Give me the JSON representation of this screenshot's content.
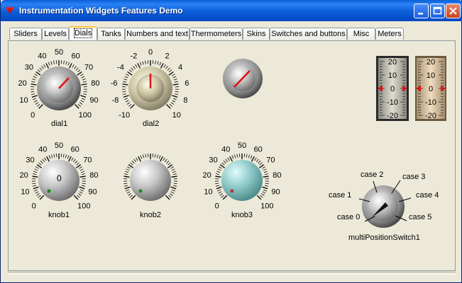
{
  "window": {
    "title": "Instrumentation Widgets Features Demo"
  },
  "tabs": [
    {
      "label": "Sliders"
    },
    {
      "label": "Levels"
    },
    {
      "label": "Dials"
    },
    {
      "label": "Tanks"
    },
    {
      "label": "Numbers and text"
    },
    {
      "label": "Thermometers"
    },
    {
      "label": "Skins"
    },
    {
      "label": "Switches and buttons"
    },
    {
      "label": "Misc"
    },
    {
      "label": "Meters"
    }
  ],
  "active_tab": "Dials",
  "dials": {
    "dial1": {
      "label": "dial1",
      "ticks": [
        "0",
        "10",
        "20",
        "30",
        "40",
        "50",
        "60",
        "70",
        "80",
        "90",
        "100"
      ],
      "value": 60
    },
    "dial2": {
      "label": "dial2",
      "ticks": [
        "-10",
        "-8",
        "-6",
        "-4",
        "-2",
        "0",
        "2",
        "4",
        "6",
        "8",
        "10"
      ],
      "value": 0
    },
    "dial3": {
      "value": 65
    }
  },
  "knobs": {
    "knob1": {
      "label": "knob1",
      "ticks": [
        "0",
        "10",
        "20",
        "30",
        "40",
        "50",
        "60",
        "70",
        "80",
        "90",
        "100"
      ],
      "value_text": "0"
    },
    "knob2": {
      "label": "knob2"
    },
    "knob3": {
      "label": "knob3",
      "ticks": [
        "0",
        "10",
        "20",
        "30",
        "40",
        "50",
        "60",
        "70",
        "80",
        "90",
        "100"
      ]
    }
  },
  "meters": {
    "scale": [
      "20",
      "10",
      "0",
      "-10",
      "-20"
    ]
  },
  "switch": {
    "label": "multiPositionSwitch1",
    "positions": [
      "case 0",
      "case 1",
      "case 2",
      "case 3",
      "case 4",
      "case 5"
    ],
    "selected": "case 0"
  },
  "colors": {
    "accent": "#0a5fd8",
    "needle": "#e01010",
    "knob3_face": "#8cc8c8"
  }
}
